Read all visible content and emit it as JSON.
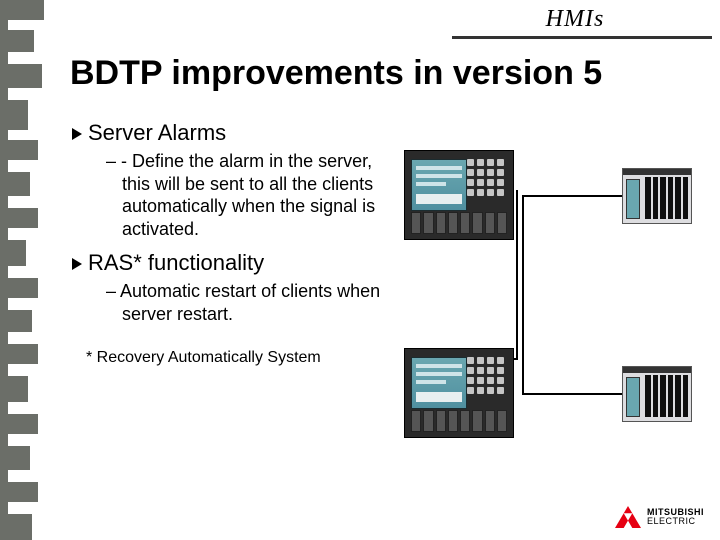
{
  "header": {
    "label": "HMIs"
  },
  "title": "BDTP improvements in version 5",
  "bullets": [
    {
      "heading": "Server Alarms",
      "sub": "– - Define the alarm in the server, this will be sent to all the clients automatically when the signal is activated."
    },
    {
      "heading": "RAS* functionality",
      "sub": "– Automatic restart of clients when server restart."
    }
  ],
  "footnote": "* Recovery Automatically System",
  "logo": {
    "line1": "MITSUBISHI",
    "line2": "ELECTRIC"
  },
  "diagram": {
    "devices": [
      {
        "role": "hmi-client-top"
      },
      {
        "role": "plc-top"
      },
      {
        "role": "hmi-server"
      },
      {
        "role": "plc-bottom"
      }
    ]
  }
}
